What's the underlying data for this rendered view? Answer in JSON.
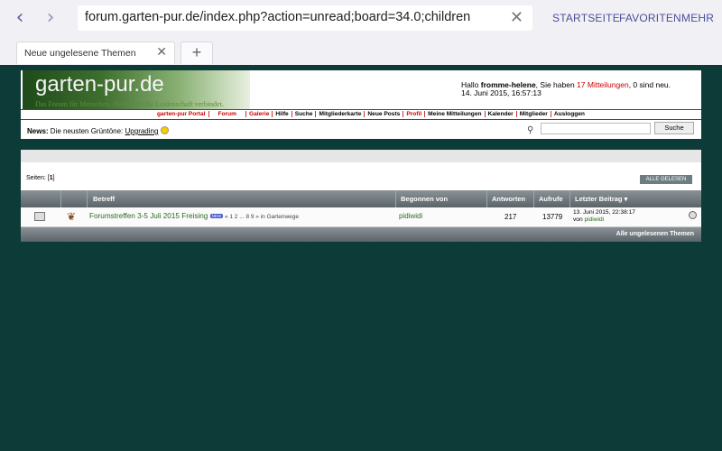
{
  "browser": {
    "back_icon": "‹",
    "forward_icon": "›",
    "url": "forum.garten-pur.de/index.php?action=unread;board=34.0;children",
    "clear_icon": "✕",
    "menu": [
      "STARTSEITE",
      "FAVORITEN",
      "MEHR"
    ],
    "tab_label": "Neue ungelesene Themen",
    "tab_close": "✕",
    "new_tab": "+"
  },
  "header": {
    "site_title": "garten-pur.de",
    "tagline": "Das Forum für Menschen, die eine große Leidenschaft verbindet.",
    "greeting_prefix": "Hallo ",
    "username": "fromme-helene",
    "greeting_mid": ", Sie haben ",
    "messages": "17 Mitteilungen",
    "greeting_suffix": ", 0 sind neu.",
    "datetime": "14. Juni 2015, 16:57:13",
    "nav": [
      "garten-pur Portal",
      "Forum",
      "Galerie",
      "Hilfe",
      "Suche",
      "Mitgliederkarte",
      "Neue Posts",
      "Profil",
      "Meine Mitteilungen",
      "Kalender",
      "Mitglieder",
      "Ausloggen"
    ],
    "news_label": "News:",
    "news_text": " Die neusten Grüntöne: ",
    "news_link": "Upgrading",
    "search_button": "Suche"
  },
  "content": {
    "pages_label": "Seiten: [",
    "pages_current": "1",
    "pages_end": "]",
    "mark_read": "ALLE GELESEN",
    "columns": {
      "subject": "Betreff",
      "started_by": "Begonnen von",
      "replies": "Antworten",
      "views": "Aufrufe",
      "last_post": "Letzter Beitrag"
    },
    "rows": [
      {
        "topic": "Forumstreffen 3-5 Juli 2015 Freising",
        "badge": "NEW",
        "pages": " « 1 2 ... 8 9 »",
        "board": " in Gartenwege",
        "starter": "pidiwidi",
        "replies": "217",
        "views": "13779",
        "last_date": "13. Juni 2015, 22:38:17",
        "last_by_label": "von ",
        "last_by": "pidiwidi"
      }
    ],
    "footer_link": "Alle ungelesenen Themen"
  }
}
